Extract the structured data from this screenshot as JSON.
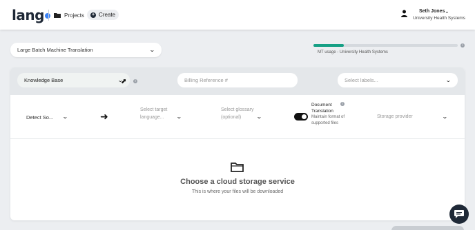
{
  "header": {
    "logo": "lang",
    "nav_projects": "Projects",
    "nav_create": "Create",
    "user_name": "Seth Jones",
    "user_org": "University Health Systems"
  },
  "job_type": {
    "selected": "Large Batch Machine Translation"
  },
  "usage": {
    "label": "MT usage - University Health Systems",
    "fraction": 0.21,
    "color": "#16a085"
  },
  "filters": {
    "knowledge_base": "Knowledge Base",
    "billing_placeholder": "Billing Reference #",
    "labels_placeholder": "Select labels..."
  },
  "settings": {
    "source": "Detect So...",
    "target_placeholder": "Select target language...",
    "glossary_placeholder": "Select glossary (optional)",
    "doc_translation_title": "Document Translation",
    "doc_translation_desc": "Maintain format of supported files",
    "doc_translation_on": true,
    "storage_placeholder": "Storage provider"
  },
  "empty_state": {
    "title": "Choose a cloud storage service",
    "subtitle": "This is where your files will be downloaded"
  }
}
